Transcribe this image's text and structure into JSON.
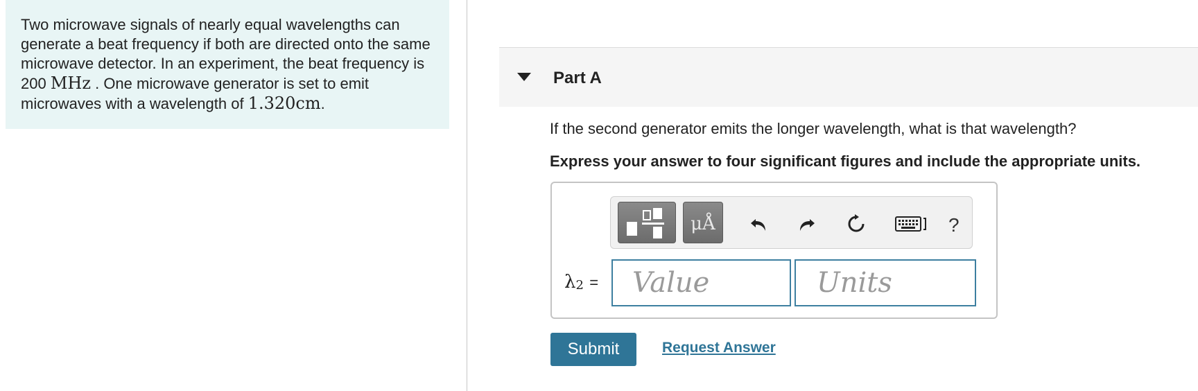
{
  "problem": {
    "text_1": "Two microwave signals of nearly equal wavelengths can generate a beat frequency if both are directed onto the same microwave detector. In an experiment, the beat frequency is 200 ",
    "beat_frequency_math": "MHz",
    "text_2": " . One microwave generator is set to emit microwaves with a wavelength of ",
    "wavelength_math": "1.320cm",
    "text_3": "."
  },
  "part": {
    "title": "Part A",
    "question": "If the second generator emits the longer wavelength, what is that wavelength?",
    "instructions": "Express your answer to four significant figures and include the appropriate units."
  },
  "toolbar": {
    "units_button_label": "μÅ",
    "help_label": "?"
  },
  "answer": {
    "variable": "λ",
    "subscript": "2",
    "equals": "=",
    "value_placeholder": "Value",
    "units_placeholder": "Units"
  },
  "actions": {
    "submit_label": "Submit",
    "request_answer_label": "Request Answer"
  },
  "colors": {
    "problem_bg": "#e8f5f5",
    "accent": "#2f7597",
    "input_border": "#3d7fa0"
  }
}
